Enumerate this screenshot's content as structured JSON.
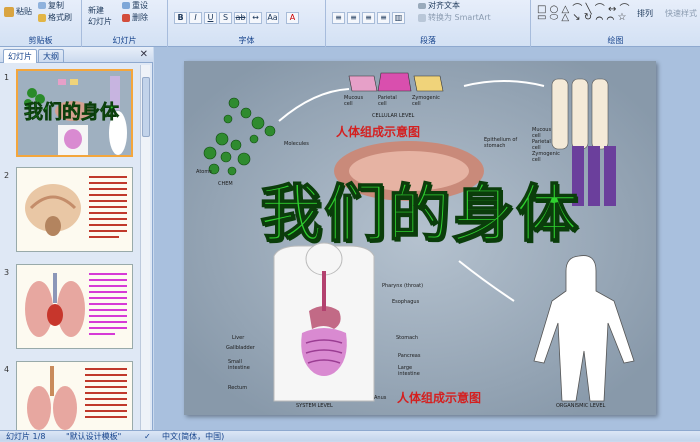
{
  "ribbon": {
    "clipboard": {
      "paste": "粘贴",
      "copy": "复制",
      "format_painter": "格式刷",
      "label": "剪贴板"
    },
    "slides": {
      "new_slide": "新建",
      "new_slide_line2": "幻灯片",
      "reset": "重设",
      "delete": "删除",
      "label": "幻灯片"
    },
    "font": {
      "label": "字体"
    },
    "paragraph": {
      "align_text": "对齐文本",
      "convert_smartart": "转换为 SmartArt",
      "label": "段落"
    },
    "drawing": {
      "arrange": "排列",
      "quick_styles": "快速样式",
      "label": "绘图"
    }
  },
  "pane": {
    "tab_slides": "幻灯片",
    "tab_outline": "大纲",
    "close_icon": "close-icon",
    "thumbnails": [
      {
        "num": "1",
        "title": "我们的身体"
      },
      {
        "num": "2"
      },
      {
        "num": "3"
      },
      {
        "num": "4"
      }
    ]
  },
  "slide": {
    "title": "我们的身体",
    "caption_top": "人体组成示意图",
    "caption_bottom": "人体组成示意图",
    "labels": {
      "cellular_level": "CELLULAR LEVEL",
      "mucous": "Mucous cell",
      "parietal": "Parietal cell",
      "zymogenic": "Zymogenic cell",
      "molecules": "Molecules",
      "atoms": "Atoms",
      "chem": "CHEM",
      "epithelium": "Epithelium of stomach",
      "mucous_cell": "Mucous cell",
      "parietal_cell": "Parietal cell",
      "zymogenic_cell": "Zymogenic cell",
      "pharynx": "Pharynx (throat)",
      "esophagus": "Esophagus",
      "liver": "Liver",
      "gallbladder": "Gallbladder",
      "small_intestine": "Small intestine",
      "stomach": "Stomach",
      "pancreas": "Pancreas",
      "large_intestine": "Large intestine",
      "rectum": "Rectum",
      "anus": "Anus",
      "system_level": "SYSTEM LEVEL",
      "organismic_level": "ORGANISMIC LEVEL"
    }
  },
  "status": {
    "slide_count": "幻灯片 1/8",
    "theme": "\"默认设计模板\"",
    "language": "中文(简体，中国)"
  }
}
